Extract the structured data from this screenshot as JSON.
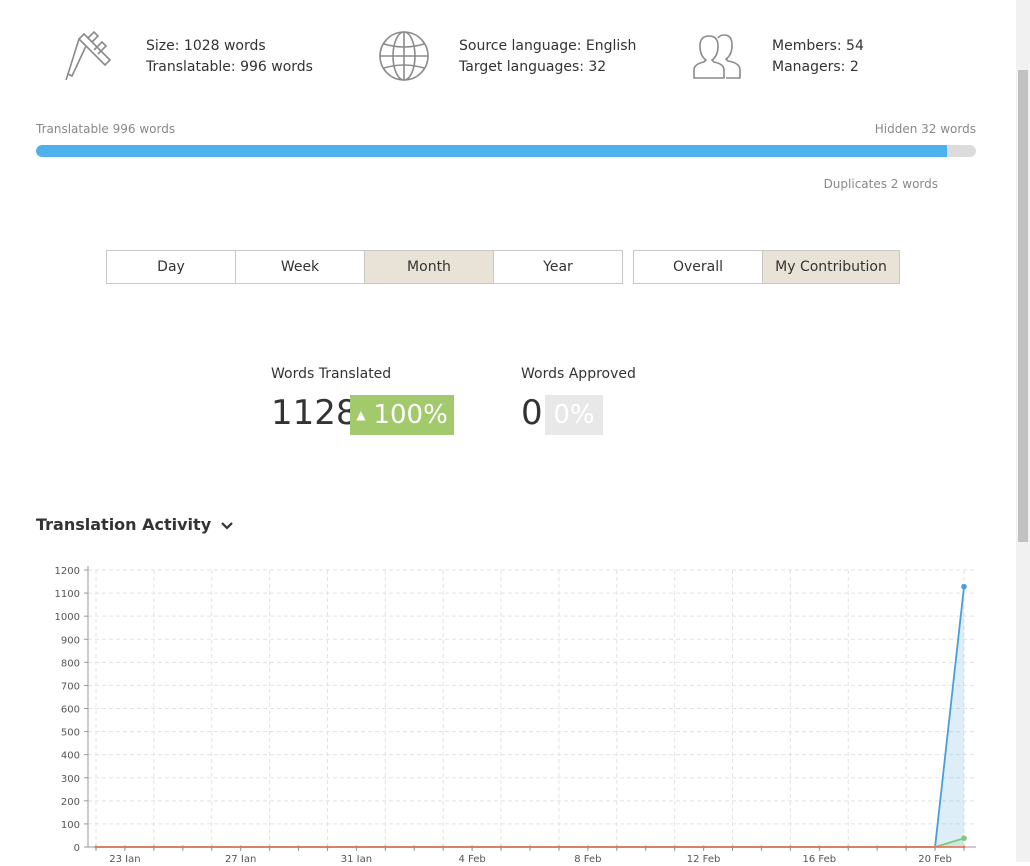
{
  "stats": {
    "size": "Size: 1028 words",
    "translatable": "Translatable: 996 words",
    "source_language": "Source language: English",
    "target_languages": "Target languages: 32",
    "members": "Members: 54",
    "managers": "Managers: 2"
  },
  "icons": {
    "caliper": "caliper-icon",
    "globe": "globe-icon",
    "members": "users-icon"
  },
  "progress": {
    "left_label": "Translatable 996 words",
    "right_label": "Hidden 32 words",
    "duplicates_label": "Duplicates 2 words",
    "fill_fraction": 0.969,
    "fill_color": "#4db2ec",
    "track_color": "#dcdcdc"
  },
  "period_tabs": [
    {
      "label": "Day",
      "active": false
    },
    {
      "label": "Week",
      "active": false
    },
    {
      "label": "Month",
      "active": true
    },
    {
      "label": "Year",
      "active": false
    }
  ],
  "scope_tabs": [
    {
      "label": "Overall",
      "active": false
    },
    {
      "label": "My Contribution",
      "active": true
    }
  ],
  "metrics": {
    "translated_label": "Words Translated",
    "translated_value": "1128",
    "translated_change": "100%",
    "approved_label": "Words Approved",
    "approved_value": "0",
    "approved_change": "0%"
  },
  "section": {
    "title": "Translation Activity"
  },
  "colors": {
    "accent_green": "#a2c96b",
    "active_tab": "#e8e3d6",
    "translated_line": "#4a9fd8",
    "approved_line": "#7fc97f"
  },
  "chart_data": {
    "type": "line",
    "title": "",
    "xlabel": "",
    "ylabel": "",
    "ylim": [
      0,
      1200
    ],
    "yticks": [
      0,
      100,
      200,
      300,
      400,
      500,
      600,
      700,
      800,
      900,
      1000,
      1100,
      1200
    ],
    "xtick_labels": [
      "23 Jan",
      "27 Jan",
      "31 Jan",
      "4 Feb",
      "8 Feb",
      "12 Feb",
      "16 Feb",
      "20 Feb"
    ],
    "x": [
      "22 Jan",
      "23 Jan",
      "24 Jan",
      "25 Jan",
      "26 Jan",
      "27 Jan",
      "28 Jan",
      "29 Jan",
      "30 Jan",
      "31 Jan",
      "1 Feb",
      "2 Feb",
      "3 Feb",
      "4 Feb",
      "5 Feb",
      "6 Feb",
      "7 Feb",
      "8 Feb",
      "9 Feb",
      "10 Feb",
      "11 Feb",
      "12 Feb",
      "13 Feb",
      "14 Feb",
      "15 Feb",
      "16 Feb",
      "17 Feb",
      "18 Feb",
      "19 Feb",
      "20 Feb",
      "21 Feb"
    ],
    "grid": true,
    "series": [
      {
        "values": [
          0,
          0,
          0,
          0,
          0,
          0,
          0,
          0,
          0,
          0,
          0,
          0,
          0,
          0,
          0,
          0,
          0,
          0,
          0,
          0,
          0,
          0,
          0,
          0,
          0,
          0,
          0,
          0,
          0,
          0,
          1128
        ],
        "color": "#4a9fd8",
        "fill": true
      },
      {
        "values": [
          0,
          0,
          0,
          0,
          0,
          0,
          0,
          0,
          0,
          0,
          0,
          0,
          0,
          0,
          0,
          0,
          0,
          0,
          0,
          0,
          0,
          0,
          0,
          0,
          0,
          0,
          0,
          0,
          0,
          0,
          38
        ],
        "color": "#7fc97f",
        "fill": true
      },
      {
        "values": [
          0,
          0,
          0,
          0,
          0,
          0,
          0,
          0,
          0,
          0,
          0,
          0,
          0,
          0,
          0,
          0,
          0,
          0,
          0,
          0,
          0,
          0,
          0,
          0,
          0,
          0,
          0,
          0,
          0,
          0,
          0
        ],
        "color": "#e07a5f",
        "fill": false
      }
    ]
  }
}
